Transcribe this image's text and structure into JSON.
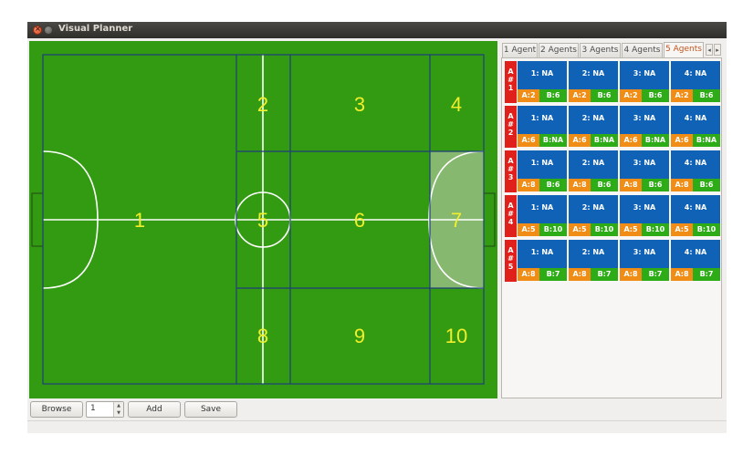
{
  "window": {
    "title": "Visual Planner",
    "close_glyph": "×"
  },
  "field": {
    "colors": {
      "grass": "#339b12",
      "zone_line": "#1f3e7a",
      "pitch_line": "#ffffff",
      "zone_label": "#f2ee2a",
      "highlight": "#86b86f"
    },
    "zones": [
      {
        "id": "1",
        "label": "1"
      },
      {
        "id": "2",
        "label": "2"
      },
      {
        "id": "3",
        "label": "3"
      },
      {
        "id": "4",
        "label": "4"
      },
      {
        "id": "5",
        "label": "5"
      },
      {
        "id": "6",
        "label": "6"
      },
      {
        "id": "7",
        "label": "7"
      },
      {
        "id": "8",
        "label": "8"
      },
      {
        "id": "9",
        "label": "9"
      },
      {
        "id": "10",
        "label": "10"
      }
    ]
  },
  "tabs": {
    "items": [
      "1 Agent",
      "2 Agents",
      "3 Agents",
      "4 Agents",
      "5 Agents"
    ],
    "active": "5 Agents",
    "scroll_left": "◂",
    "scroll_right": "▸"
  },
  "agents": [
    {
      "tag": [
        "A",
        "#",
        "1"
      ],
      "cells": [
        {
          "top": "1: NA",
          "a": "A:2",
          "b": "B:6"
        },
        {
          "top": "2: NA",
          "a": "A:2",
          "b": "B:6"
        },
        {
          "top": "3: NA",
          "a": "A:2",
          "b": "B:6"
        },
        {
          "top": "4: NA",
          "a": "A:2",
          "b": "B:6"
        }
      ]
    },
    {
      "tag": [
        "A",
        "#",
        "2"
      ],
      "cells": [
        {
          "top": "1: NA",
          "a": "A:6",
          "b": "B:NA"
        },
        {
          "top": "2: NA",
          "a": "A:6",
          "b": "B:NA"
        },
        {
          "top": "3: NA",
          "a": "A:6",
          "b": "B:NA"
        },
        {
          "top": "4: NA",
          "a": "A:6",
          "b": "B:NA"
        }
      ]
    },
    {
      "tag": [
        "A",
        "#",
        "3"
      ],
      "cells": [
        {
          "top": "1: NA",
          "a": "A:8",
          "b": "B:6"
        },
        {
          "top": "2: NA",
          "a": "A:8",
          "b": "B:6"
        },
        {
          "top": "3: NA",
          "a": "A:8",
          "b": "B:6"
        },
        {
          "top": "4: NA",
          "a": "A:8",
          "b": "B:6"
        }
      ]
    },
    {
      "tag": [
        "A",
        "#",
        "4"
      ],
      "cells": [
        {
          "top": "1: NA",
          "a": "A:5",
          "b": "B:10"
        },
        {
          "top": "2: NA",
          "a": "A:5",
          "b": "B:10"
        },
        {
          "top": "3: NA",
          "a": "A:5",
          "b": "B:10"
        },
        {
          "top": "4: NA",
          "a": "A:5",
          "b": "B:10"
        }
      ]
    },
    {
      "tag": [
        "A",
        "#",
        "5"
      ],
      "cells": [
        {
          "top": "1: NA",
          "a": "A:8",
          "b": "B:7"
        },
        {
          "top": "2: NA",
          "a": "A:8",
          "b": "B:7"
        },
        {
          "top": "3: NA",
          "a": "A:8",
          "b": "B:7"
        },
        {
          "top": "4: NA",
          "a": "A:8",
          "b": "B:7"
        }
      ]
    }
  ],
  "toolbar": {
    "browse_label": "Browse",
    "spin_value": "1",
    "add_label": "Add",
    "save_label": "Save"
  }
}
